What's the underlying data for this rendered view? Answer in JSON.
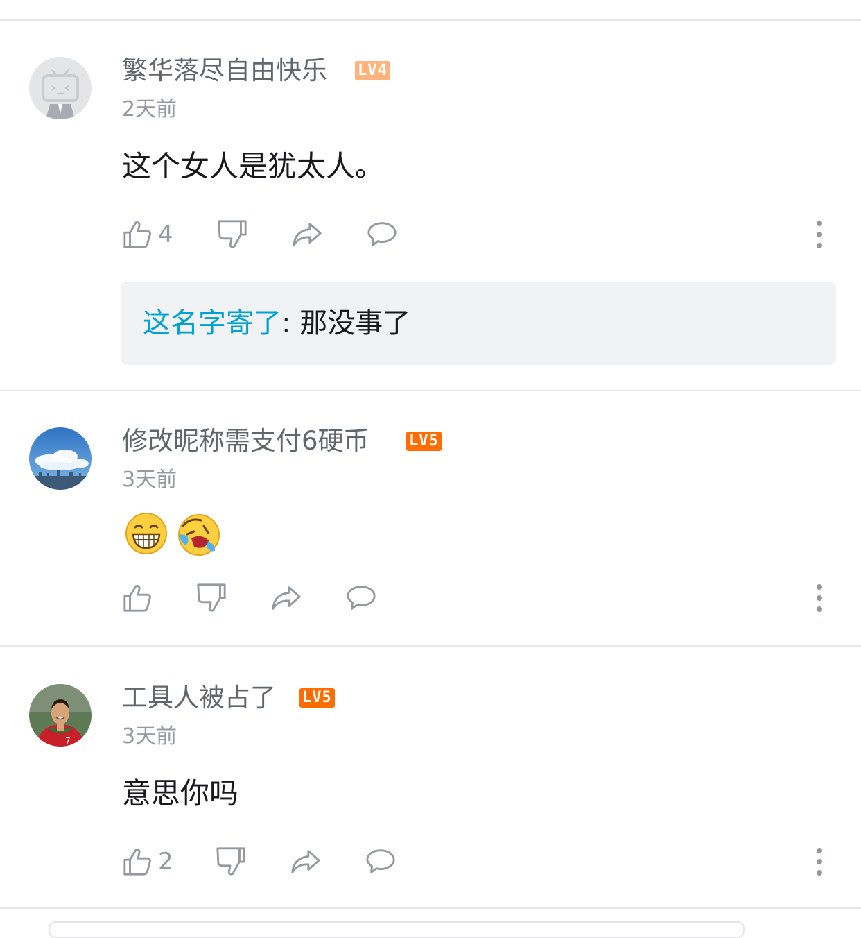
{
  "comments": [
    {
      "username": "繁华落尽自由快乐",
      "level": "LV4",
      "avatar": "default-tv-avatar",
      "time": "2天前",
      "content": "这个女人是犹太人。",
      "likes": "4",
      "reply": {
        "name": "这名字寄了",
        "separator": ":",
        "text": "那没事了"
      }
    },
    {
      "username": "修改昵称需支付6硬币",
      "level": "LV5",
      "avatar": "sky-clouds-avatar",
      "time": "3天前",
      "emojis": [
        "grin-emoji",
        "laugh-cry-emoji"
      ],
      "likes": ""
    },
    {
      "username": "工具人被占了",
      "level": "LV5",
      "avatar": "soccer-player-avatar",
      "time": "3天前",
      "content": "意思你吗",
      "likes": "2"
    }
  ],
  "colors": {
    "username": "#61666d",
    "meta": "#9499a0",
    "link": "#00a1d6",
    "lv4": "#ffb37c",
    "lv5": "#ff6c00"
  }
}
